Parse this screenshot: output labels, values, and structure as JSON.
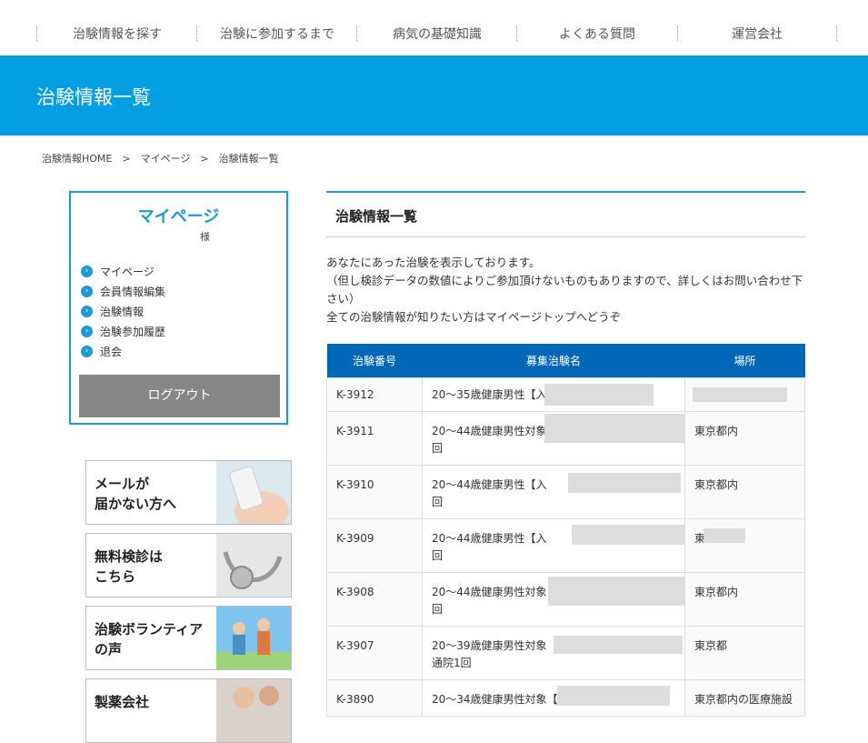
{
  "nav": {
    "items": [
      "治験情報を探す",
      "治験に参加するまで",
      "病気の基礎知識",
      "よくある質問",
      "運営会社"
    ]
  },
  "banner": {
    "title": "治験情報一覧"
  },
  "breadcrumb": {
    "items": [
      "治験情報HOME",
      "マイページ",
      "治験情報一覧"
    ],
    "separator": ">"
  },
  "mypage": {
    "title": "マイページ",
    "honorific": "様",
    "menu": [
      "マイページ",
      "会員情報編集",
      "治験情報",
      "治験参加履歴",
      "退会"
    ],
    "logout": "ログアウト"
  },
  "side_banners": [
    {
      "text": "メールが\n届かない方へ"
    },
    {
      "text": "無料検診は\nこちら"
    },
    {
      "text": "治験ボランティア\nの声"
    },
    {
      "text": "製薬会社"
    }
  ],
  "main": {
    "heading": "治験情報一覧",
    "intro": [
      "あなたにあった治験を表示しております。",
      "（但し検診データの数値によりご参加頂けないものもありますので、詳しくはお問い合わせ下さい）",
      "全ての治験情報が知りたい方はマイページトップへどうぞ"
    ],
    "table": {
      "headers": [
        "治験番号",
        "募集治験名",
        "場所"
      ],
      "rows": [
        {
          "id": "K-3912",
          "name": "20～35歳健康男性【入院",
          "place": ""
        },
        {
          "id": "K-3911",
          "name": "20～44歳健康男性対象\n回",
          "place": "東京都内"
        },
        {
          "id": "K-3910",
          "name": "20～44歳健康男性【入\n回",
          "place": "東京都内"
        },
        {
          "id": "K-3909",
          "name": "20～44歳健康男性【入\n回",
          "place": "東"
        },
        {
          "id": "K-3908",
          "name": "20～44歳健康男性対象\n回",
          "place": "東京都内"
        },
        {
          "id": "K-3907",
          "name": "20～39歳健康男性対象【\n通院1回",
          "place": "東京都"
        },
        {
          "id": "K-3890",
          "name": "20～34歳健康男性対象【",
          "place": "東京都内の医療施設"
        }
      ]
    }
  },
  "colors": {
    "accent": "#049ee2",
    "table_header": "#0068b7",
    "logout_bg": "#868686"
  }
}
